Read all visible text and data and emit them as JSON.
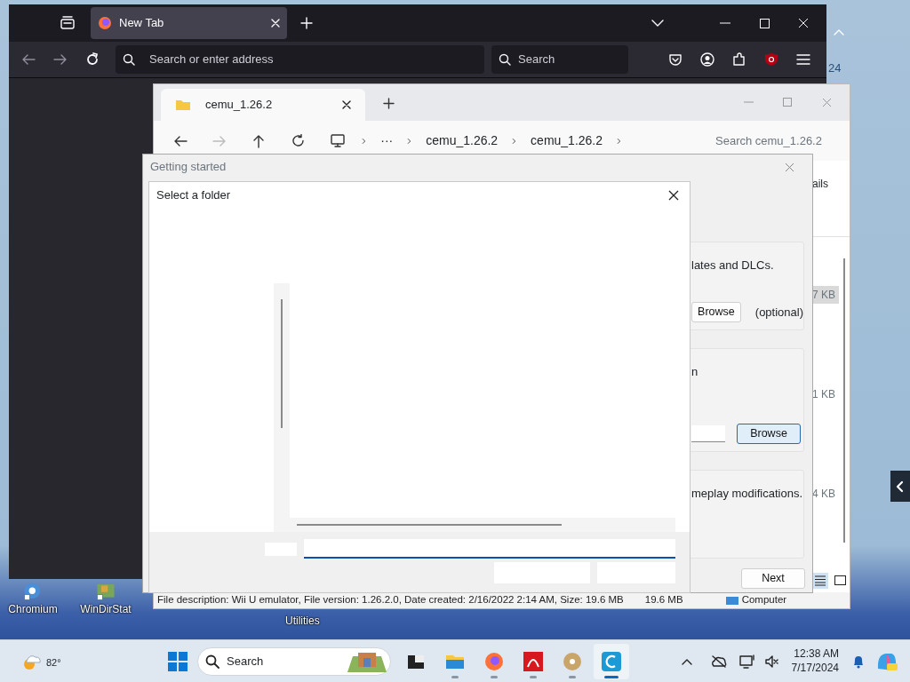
{
  "browser": {
    "tab": {
      "title": "New Tab",
      "selected": true
    },
    "address_placeholder": "Search or enter address",
    "search_placeholder": "Search"
  },
  "explorer": {
    "tab": {
      "title": "cemu_1.26.2",
      "selected": true
    },
    "breadcrumb": [
      "···",
      "cemu_1.26.2",
      "cemu_1.26.2"
    ],
    "search_placeholder": "Search cemu_1.26.2",
    "header_fragment": "ails",
    "sizes": [
      {
        "text": "7 KB",
        "selected": true
      },
      {
        "text": "1 KB",
        "selected": false
      },
      {
        "text": "4 KB",
        "selected": false
      }
    ],
    "status": "File description: Wii U emulator, File version: 1.26.2.0, Date created: 2/16/2022 2:14 AM, Size: 19.6 MB",
    "status_size": "19.6 MB",
    "nav_item": "Computer"
  },
  "getting_started": {
    "title": "Getting started",
    "sections": [
      {
        "text": "lates and DLCs.",
        "button": "Browse",
        "note": "(optional)",
        "field": false,
        "focused": false
      },
      {
        "text": "n",
        "button": "Browse",
        "field": true,
        "focused": true
      },
      {
        "text": "meplay modifications."
      }
    ],
    "next": "Next"
  },
  "select_folder": {
    "title": "Select a folder"
  },
  "desktop": {
    "icons": [
      {
        "label": "Chromium",
        "kind": "chromium"
      },
      {
        "label": "WinDirStat",
        "kind": "windirstat"
      }
    ],
    "utilities": "Utilities",
    "clock_fragment": "24"
  },
  "taskbar": {
    "weather": "82°",
    "search": "Search",
    "apps": [
      {
        "kind": "terminal",
        "running": false,
        "selected": false
      },
      {
        "kind": "folder",
        "running": true,
        "selected": false
      },
      {
        "kind": "firefox",
        "running": true,
        "selected": false
      },
      {
        "kind": "pdf",
        "running": true,
        "selected": false
      },
      {
        "kind": "disc",
        "running": true,
        "selected": false
      },
      {
        "kind": "cemu",
        "running": true,
        "selected": true
      }
    ],
    "time": "12:38 AM",
    "date": "7/17/2024"
  }
}
